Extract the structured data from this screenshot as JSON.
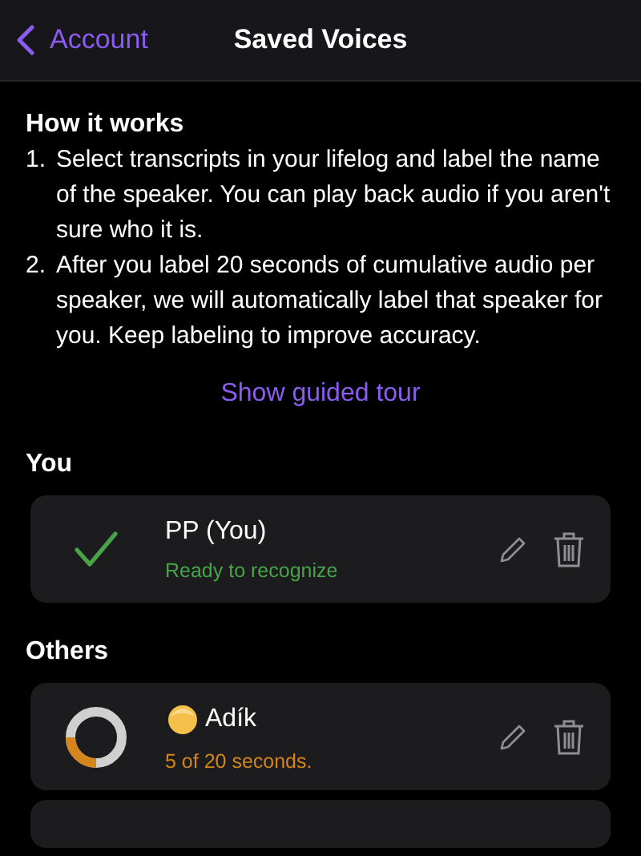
{
  "nav": {
    "back": "Account",
    "title": "Saved Voices"
  },
  "how_it_works": {
    "heading": "How it works",
    "steps": [
      {
        "number": "1.",
        "text": "Select transcripts in your lifelog and label the name of the speaker. You can play back audio if you aren't sure who it is."
      },
      {
        "number": "2.",
        "text": "After you label 20 seconds of cumulative audio per speaker, we will automatically label that speaker for you. Keep labeling to improve accuracy."
      }
    ],
    "link": "Show guided tour"
  },
  "sections": [
    {
      "heading": "You",
      "voices": [
        {
          "kind": "ready",
          "name": "PP (You)",
          "status": "Ready to recognize",
          "avatar": false
        }
      ]
    },
    {
      "heading": "Others",
      "voices": [
        {
          "kind": "progress",
          "name": "Adík",
          "status": "5 of 20 seconds.",
          "level": 0.25,
          "avatar": true
        }
      ]
    }
  ]
}
